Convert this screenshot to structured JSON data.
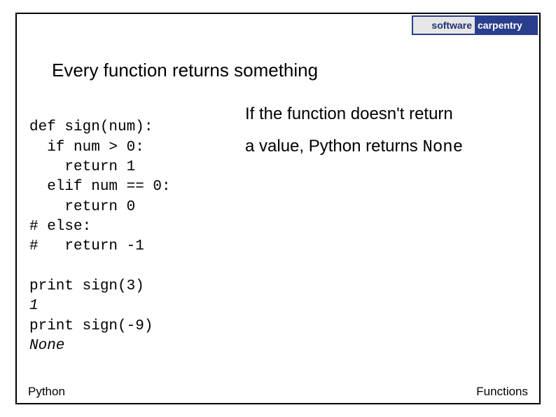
{
  "logo": {
    "left": "software",
    "right": "carpentry"
  },
  "heading": "Every function returns something",
  "code": {
    "l1": "def sign(num):",
    "l2": "  if num > 0:",
    "l3": "    return 1",
    "l4": "  elif num == 0:",
    "l5": "    return 0",
    "l6": "# else:",
    "l7": "#   return -1"
  },
  "output": {
    "p1": "print sign(3)",
    "r1": "1",
    "p2": "print sign(-9)",
    "r2": "None"
  },
  "explain": {
    "line1": "If the function doesn't return",
    "line2_a": "a value, Python returns ",
    "line2_b": "None"
  },
  "footer": {
    "left": "Python",
    "right": "Functions"
  }
}
